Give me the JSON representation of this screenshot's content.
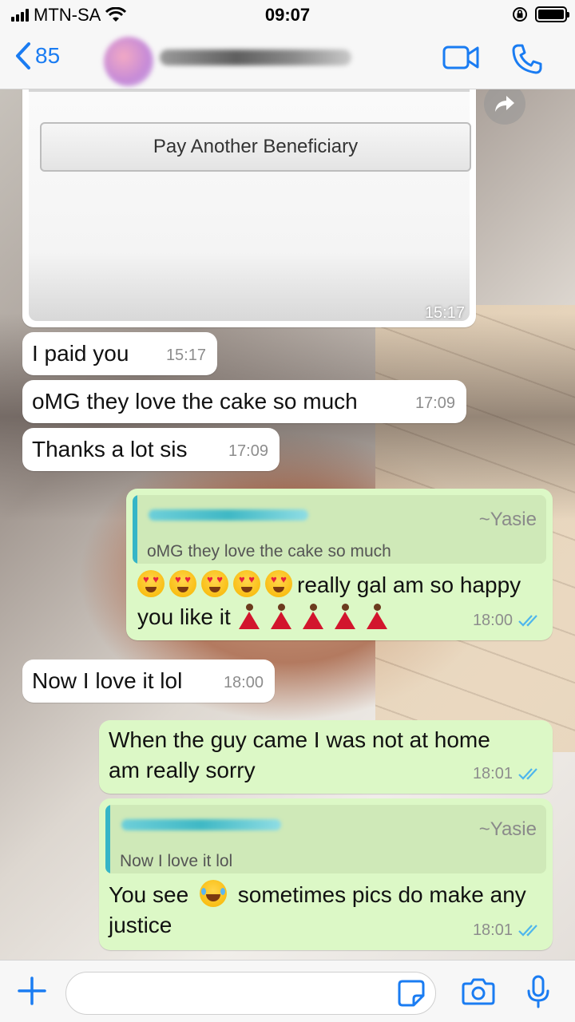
{
  "status": {
    "carrier": "MTN-SA",
    "time": "09:07",
    "icons": [
      "signal-icon",
      "wifi-icon",
      "rotation-lock-icon",
      "battery-icon"
    ]
  },
  "header": {
    "back_count": "85",
    "icons": [
      "chevron-left-icon",
      "video-camera-icon",
      "phone-icon"
    ],
    "accent": "#1a7cf2"
  },
  "chat": {
    "image_message": {
      "button_label": "Pay Another Beneficiary",
      "time": "15:17"
    },
    "messages": [
      {
        "text": "I paid you",
        "time": "15:17",
        "direction": "in"
      },
      {
        "text": "oMG they love the cake so much",
        "time": "17:09",
        "direction": "in"
      },
      {
        "text": "Thanks a lot sis",
        "time": "17:09",
        "direction": "in"
      },
      {
        "direction": "out",
        "quote_sender": "~Yasie",
        "quote_text": "oMG they love the cake so much",
        "text_line1": "really gal am so happy",
        "text_line2": "you like it",
        "time": "18:00",
        "status": "read"
      },
      {
        "text": "Now I love it lol",
        "time": "18:00",
        "direction": "in"
      },
      {
        "direction": "out",
        "text_line1": "When the guy came I was not at home",
        "text_line2": "am really sorry",
        "time": "18:01",
        "status": "read"
      },
      {
        "direction": "out",
        "quote_sender": "~Yasie",
        "quote_text": "Now I love it lol",
        "text_line1a": "You see",
        "text_line1b": "sometimes pics do make any",
        "text_line2": "justice",
        "time": "18:01",
        "status": "read"
      }
    ],
    "colors": {
      "incoming": "#ffffff",
      "outgoing": "#dcf8c6",
      "read_tick": "#4fb6ec"
    }
  },
  "input": {
    "placeholder": "",
    "icons": [
      "plus-icon",
      "sticker-icon",
      "camera-icon",
      "microphone-icon"
    ]
  }
}
